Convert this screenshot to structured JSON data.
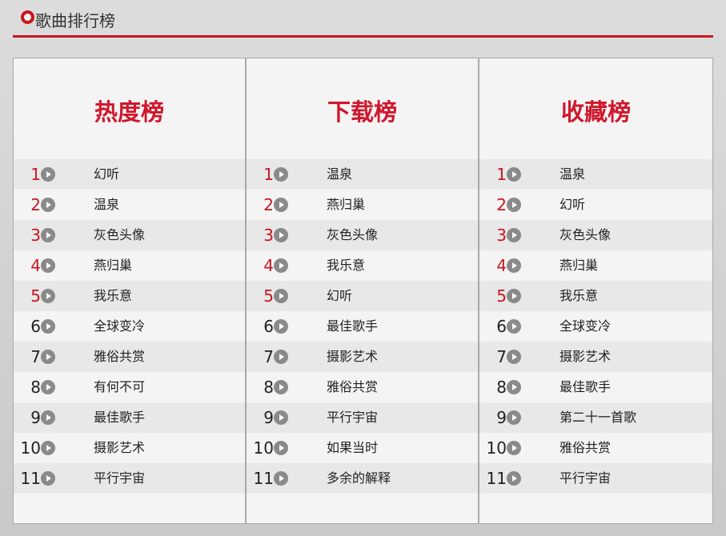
{
  "header": {
    "title": "歌曲排行榜",
    "accent": "#c8161d"
  },
  "boards": [
    {
      "title": "热度榜",
      "songs": [
        "幻听",
        "温泉",
        "灰色头像",
        "燕归巢",
        "我乐意",
        "全球变冷",
        "雅俗共赏",
        "有何不可",
        "最佳歌手",
        "摄影艺术",
        "平行宇宙"
      ]
    },
    {
      "title": "下载榜",
      "songs": [
        "温泉",
        "燕归巢",
        "灰色头像",
        "我乐意",
        "幻听",
        "最佳歌手",
        "摄影艺术",
        "雅俗共赏",
        "平行宇宙",
        "如果当时",
        "多余的解释"
      ]
    },
    {
      "title": "收藏榜",
      "songs": [
        "温泉",
        "幻听",
        "灰色头像",
        "燕归巢",
        "我乐意",
        "全球变冷",
        "摄影艺术",
        "最佳歌手",
        "第二十一首歌",
        "雅俗共赏",
        "平行宇宙"
      ]
    }
  ],
  "ranks": [
    "1",
    "2",
    "3",
    "4",
    "5",
    "6",
    "7",
    "8",
    "9",
    "10",
    "11"
  ],
  "top_rank_count": 5,
  "icons": {
    "header": "record-icon",
    "play": "play-icon"
  },
  "colors": {
    "title_red": "#d0162b",
    "rank_red": "#c8161d",
    "play_gray": "#8a8a8a"
  }
}
